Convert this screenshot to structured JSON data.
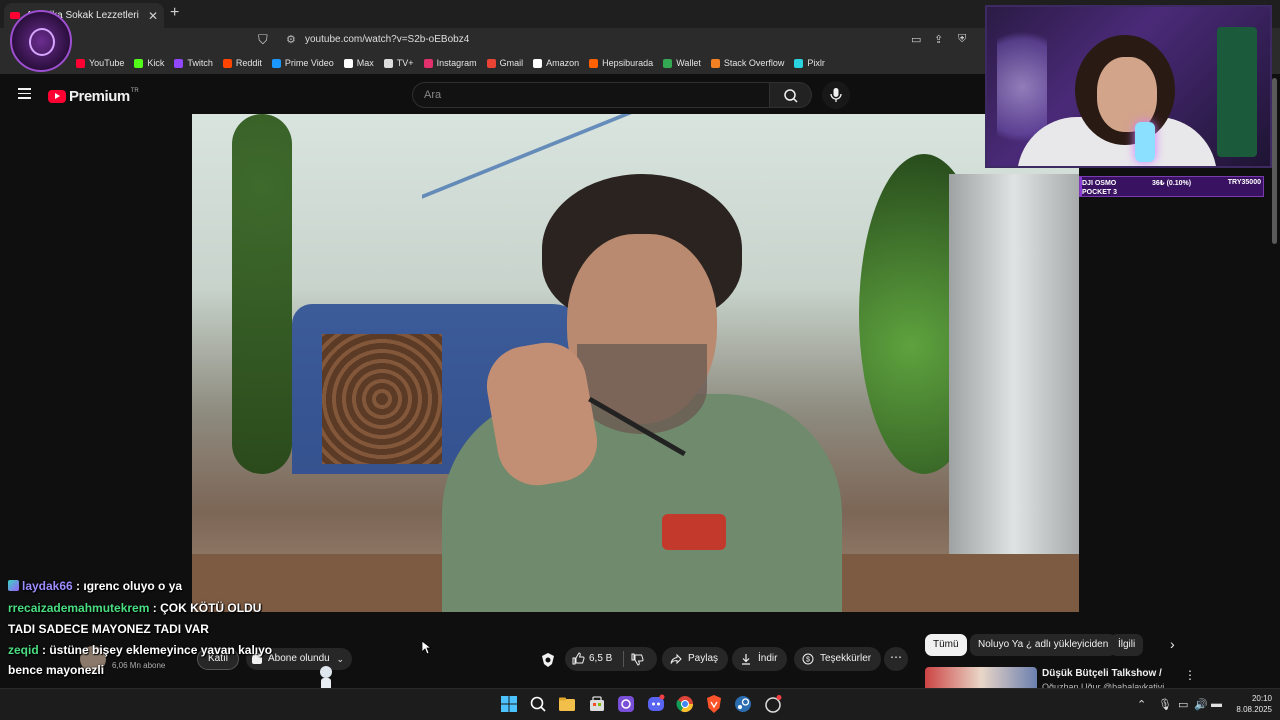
{
  "browser": {
    "tab_title": "Amerika Sokak Lezzetleri",
    "tab_close": "✕",
    "new_tab": "+",
    "url": "youtube.com/watch?v=S2b-oEBobz4",
    "bookmarks": [
      {
        "label": "YouTube",
        "color": "#ff0033"
      },
      {
        "label": "Kick",
        "color": "#53fc18"
      },
      {
        "label": "Twitch",
        "color": "#9146ff"
      },
      {
        "label": "Reddit",
        "color": "#ff4500"
      },
      {
        "label": "Prime Video",
        "color": "#1a98ff"
      },
      {
        "label": "Max",
        "color": "#ffffff"
      },
      {
        "label": "TV+",
        "color": "#dddddd"
      },
      {
        "label": "Instagram",
        "color": "#e1306c"
      },
      {
        "label": "Gmail",
        "color": "#ea4335"
      },
      {
        "label": "Amazon",
        "color": "#ffffff"
      },
      {
        "label": "Hepsiburada",
        "color": "#ff6000"
      },
      {
        "label": "Wallet",
        "color": "#34a853"
      },
      {
        "label": "Stack Overflow",
        "color": "#f48024"
      },
      {
        "label": "Pixlr",
        "color": "#29d3e0"
      }
    ]
  },
  "youtube": {
    "logo_text": "Premium",
    "logo_region": "TR",
    "search_placeholder": "Ara",
    "channel_subs": "6,06 Mn abone",
    "join_label": "Katıl",
    "subscribed_label": "Abone olundu",
    "likes": "6,5 B",
    "share_label": "Paylaş",
    "download_label": "İndir",
    "thanks_label": "Teşekkürler",
    "more_label": "⋯",
    "chips": [
      "Tümü",
      "Noluyo Ya ¿ adlı yükleyiciden",
      "İlgili"
    ],
    "rec_title": "Düşük Bütçeli Talkshow /",
    "rec_subtitle": "Oğuzhan Uğur @babalavkativi"
  },
  "stream": {
    "goal_name_1": "DJI OSMO",
    "goal_name_2": "POCKET 3",
    "goal_progress": "36₺ (0.10%)",
    "goal_target": "TRY35000",
    "goal_fraction": 0.001
  },
  "chat": [
    {
      "user": "laydak66",
      "color": "#9b8cff",
      "text": " : ıgrenc oluyo o ya",
      "badge": true
    },
    {
      "user": "rrecaizademahmutekrem",
      "color": "#4ade80",
      "text": " : ÇOK KÖTÜ OLDU",
      "badge": false
    },
    {
      "user": "",
      "color": "#ffffff",
      "text": "TADI SADECE MAYONEZ TADI VAR",
      "badge": false
    },
    {
      "user": "zeqid",
      "color": "#4ade80",
      "text": " : üstüne bişey eklemeyince yavan kalıyo",
      "badge": false
    },
    {
      "user": "",
      "color": "#ffffff",
      "text": "bence mayonezli",
      "badge": false
    }
  ],
  "taskbar": {
    "time": "20:10",
    "date": "8.08.2025"
  },
  "colors": {
    "youtube_red": "#ff0033",
    "accent_purple": "#8a3bd6"
  }
}
